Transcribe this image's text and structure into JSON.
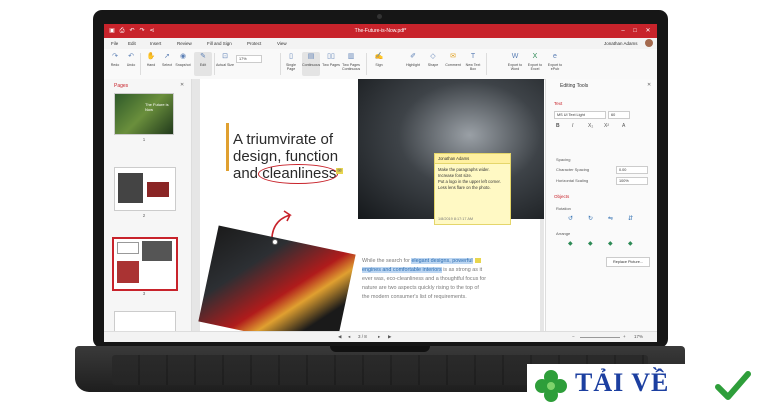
{
  "app": {
    "title": "The-Future-is-Now.pdf*",
    "user": "Jonathan Adams"
  },
  "menu": [
    "File",
    "Edit",
    "Insert",
    "Review",
    "Fill and Sign",
    "Protect",
    "View"
  ],
  "ribbon": {
    "buttons": [
      "Redo",
      "Undo",
      "Hand",
      "Select",
      "Snapshot",
      "Edit",
      "Actual Size",
      "Single Page",
      "Continuous",
      "Two Pages",
      "Two Pages Continuous",
      "Sign",
      "Highlight",
      "Shape",
      "Comment",
      "New Text Box",
      "Export to Word",
      "Export to Excel",
      "Export to ePub"
    ],
    "zoom": "17%"
  },
  "pages_panel": {
    "title": "Pages",
    "thumb1_text": "The Future is Now",
    "page_numbers": [
      "1",
      "2",
      "3"
    ]
  },
  "document": {
    "headline": [
      "A triumvirate of",
      "design, function",
      "and cleanliness"
    ],
    "body_lines": [
      {
        "plain": "While the search for ",
        "highlight": "elegant designs, powerful"
      },
      {
        "plain": "",
        "highlight": "engines and comfortable interiors",
        "rest": " is as strong as it"
      },
      {
        "plain": "ever was, eco-cleanliness and a thoughtful focus for"
      },
      {
        "plain": "nature are two aspects quickly rising to the top of"
      },
      {
        "plain": "the modern consumer's list of requirements."
      }
    ]
  },
  "note": {
    "author": "Jonathan Adams",
    "lines": [
      "Make the paragraphs wider.",
      "Increase font size.",
      "Put a logo in the upper left corner.",
      "Less lens flare on the photo."
    ],
    "timestamp": "1/8/2019 8:17:17 AM"
  },
  "editing_tools": {
    "title": "Editing Tools",
    "text_section": "Text",
    "font": "MS UI Text Light",
    "font_size": "60",
    "spacing_label": "Spacing",
    "char_spacing_label": "Character Spacing",
    "char_spacing_value": "0.00",
    "horiz_scaling_label": "Horizontal Scaling",
    "horiz_scaling_value": "100%",
    "objects_section": "Objects",
    "rotation_label": "Rotation",
    "arrange_label": "Arrange",
    "replace_button": "Replace Picture..."
  },
  "status": {
    "page_indicator": "3 / 8",
    "zoom": "17%"
  },
  "watermark": {
    "text": "TẢI VỀ"
  },
  "colors": {
    "brand": "#c8232b",
    "highlight": "#bcd6f2",
    "note": "#fff9c4"
  }
}
